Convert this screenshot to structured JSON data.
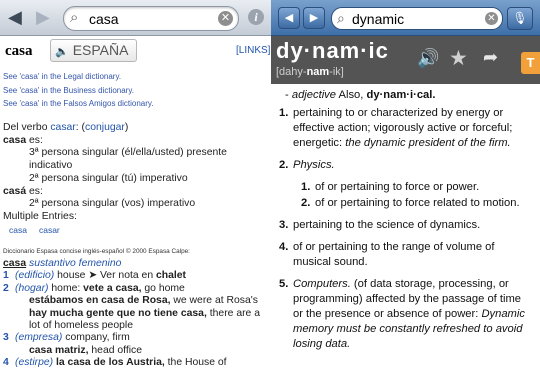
{
  "left": {
    "toolbar": {
      "search_value": "casa"
    },
    "headword": "casa",
    "lang_button": "ESPAÑA",
    "links_label": "[LINKS]",
    "see_links": [
      "See 'casa' in the Legal dictionary.",
      "See 'casa' in the Business dictionary.",
      "See 'casa' in the Falsos Amigos dictionary."
    ],
    "verb": {
      "line_a": "Del verbo ",
      "verb_link": "casar",
      "line_b": ": (",
      "conj_link": "conjugar",
      "line_c": ")",
      "f1": "casa",
      "f1_es": " es:",
      "f1_d1": "3ª persona singular (él/ella/usted) presente indicativo",
      "f1_d2": "2ª persona singular (tú) imperativo",
      "f2": "casá",
      "f2_es": " es:",
      "f2_d1": "2ª persona singular (vos) imperativo",
      "multi": "Multiple Entries:",
      "entries": [
        "casa",
        "casar"
      ]
    },
    "copyright": "Diccionario Espasa concise inglés-español © 2000 Espasa Calpe:",
    "entry": {
      "head": "casa",
      "pos": " sustantivo femenino",
      "s1_num": "1",
      "s1_label": "(edificio)",
      "s1_text": " house ➤ Ver nota en ",
      "s1_bold": "chalet",
      "s2_num": "2",
      "s2_label": "(hogar)",
      "s2_text": " home: ",
      "s2_bold": "vete a casa,",
      "s2_text2": " go home",
      "s2_ex1": "estábamos en casa de Rosa,",
      "s2_ex1_tr": " we were at Rosa's",
      "s2_ex2": "hay mucha gente que no tiene casa,",
      "s2_ex2_tr": " there are a lot of homeless people",
      "s3_num": "3",
      "s3_label": "(empresa)",
      "s3_text": " company, firm",
      "s3_ex": "casa matriz,",
      "s3_ex_tr": " head office",
      "s4_num": "4",
      "s4_label": "(estirpe)",
      "s4_bold": " la casa de los Austria,",
      "s4_text": " the House of"
    }
  },
  "right": {
    "toolbar": {
      "search_value": "dynamic"
    },
    "word": "dy·nam·ic",
    "pron_a": "[dahy-",
    "pron_b": "nam",
    "pron_c": "-ik]",
    "tab_label": "T",
    "pos_line": {
      "dash": "- ",
      "pos": "adjective",
      "also": "  Also, ",
      "variant": "dy·nam·i·cal."
    },
    "senses": [
      {
        "n": "1.",
        "text": "pertaining to or characterized by energy or effective action; vigorously active or forceful; energetic: ",
        "ex": "the dynamic president of the firm."
      },
      {
        "n": "2.",
        "label": "Physics."
      },
      {
        "n": "3.",
        "text": "pertaining to the science of dynamics."
      },
      {
        "n": "4.",
        "text": "of or pertaining to the range of volume of musical sound."
      },
      {
        "n": "5.",
        "label": "Computers.",
        "text": "  (of data storage, processing, or programming) affected by the passage of time or the presence or absence of power: ",
        "ex": "Dynamic memory must be constantly refreshed to avoid losing data."
      }
    ],
    "physics_subs": [
      {
        "n": "1.",
        "text": "of or pertaining to force or power."
      },
      {
        "n": "2.",
        "text": "of or pertaining to force related to motion."
      }
    ]
  }
}
